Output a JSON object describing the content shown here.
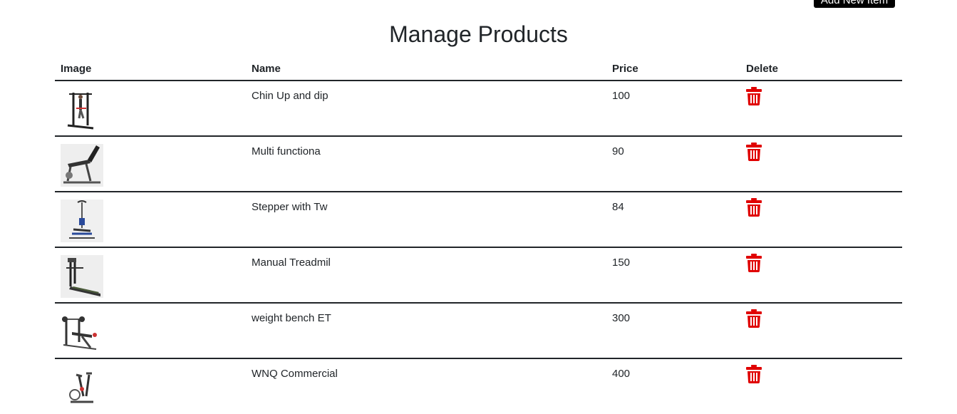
{
  "header": {
    "add_button_label": "Add New Item",
    "title": "Manage Products"
  },
  "table": {
    "columns": [
      "Image",
      "Name",
      "Price",
      "Delete"
    ],
    "rows": [
      {
        "image_icon": "chin-up-station-image",
        "name": "Chin Up and dip",
        "price": "100"
      },
      {
        "image_icon": "adjustable-bench-image",
        "name": "Multi functiona",
        "price": "90"
      },
      {
        "image_icon": "stepper-image",
        "name": "Stepper with Tw",
        "price": "84"
      },
      {
        "image_icon": "treadmill-image",
        "name": "Manual Treadmil",
        "price": "150"
      },
      {
        "image_icon": "weight-bench-image",
        "name": "weight bench ET",
        "price": "300"
      },
      {
        "image_icon": "exercise-bike-image",
        "name": "WNQ Commercial",
        "price": "400"
      }
    ]
  },
  "colors": {
    "delete_icon": "#e00000",
    "header_text": "#212529",
    "button_bg": "#000000"
  }
}
